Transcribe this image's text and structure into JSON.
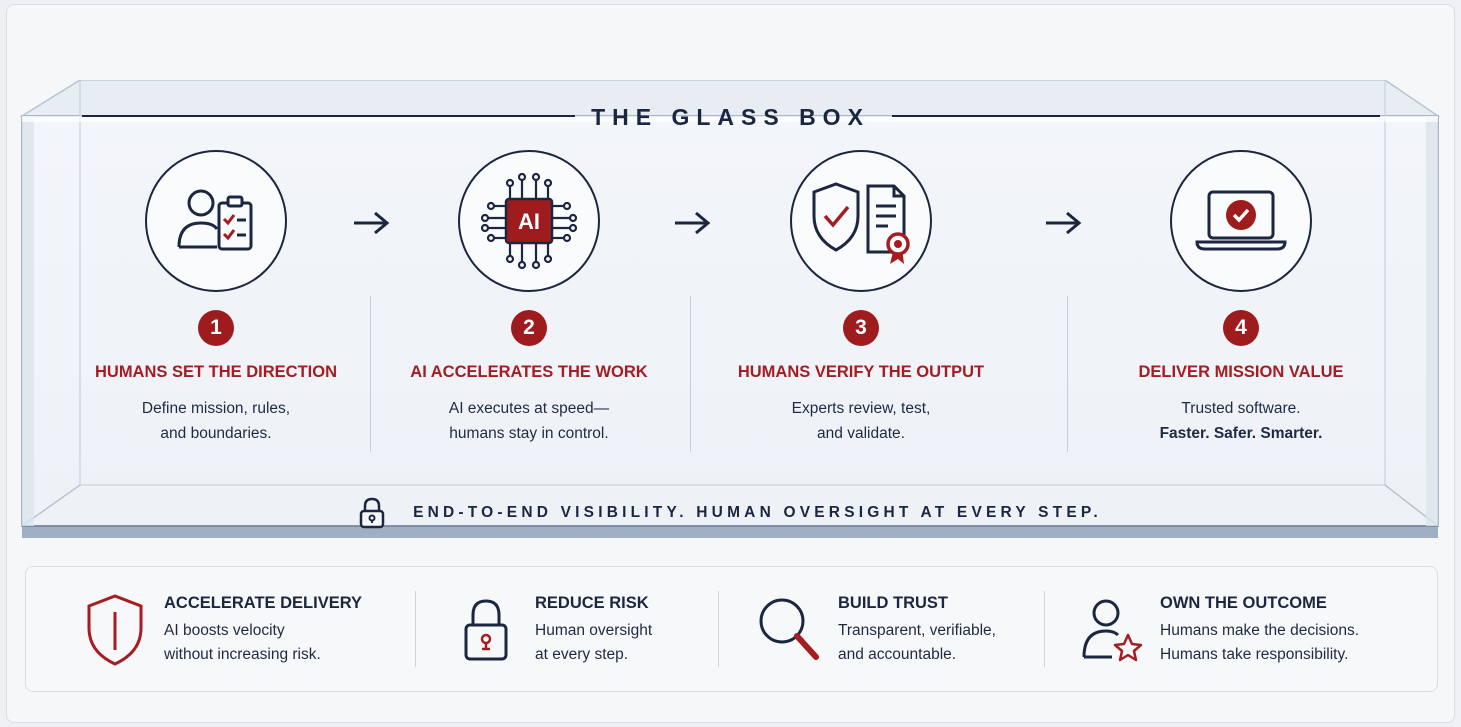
{
  "title": "THE GLASS BOX",
  "steps": [
    {
      "number": "1",
      "heading": "HUMANS SET THE DIRECTION",
      "line1": "Define mission, rules,",
      "line2": "and boundaries.",
      "icon": "person-checklist-icon"
    },
    {
      "number": "2",
      "heading": "AI ACCELERATES THE WORK",
      "line1": "AI executes at speed—",
      "line2": "humans stay in control.",
      "icon": "ai-chip-icon",
      "chip_label": "AI"
    },
    {
      "number": "3",
      "heading": "HUMANS VERIFY THE OUTPUT",
      "line1": "Experts review, test,",
      "line2": "and validate.",
      "icon": "shield-certificate-icon"
    },
    {
      "number": "4",
      "heading": "DELIVER MISSION VALUE",
      "line1": "Trusted software.",
      "line2": "Faster. Safer. Smarter.",
      "icon": "laptop-check-icon"
    }
  ],
  "footer": "END-TO-END VISIBILITY. HUMAN OVERSIGHT AT EVERY STEP.",
  "benefits": [
    {
      "title": "ACCELERATE DELIVERY",
      "line1": "AI boosts velocity",
      "line2": "without increasing risk.",
      "icon": "shield-icon"
    },
    {
      "title": "REDUCE RISK",
      "line1": "Human oversight",
      "line2": "at every step.",
      "icon": "padlock-icon"
    },
    {
      "title": "BUILD TRUST",
      "line1": "Transparent, verifiable,",
      "line2": "and accountable.",
      "icon": "magnifier-icon"
    },
    {
      "title": "OWN THE OUTCOME",
      "line1": "Humans make the decisions.",
      "line2": "Humans take responsibility.",
      "icon": "person-star-icon"
    }
  ],
  "colors": {
    "navy": "#1b2640",
    "red": "#a51d21",
    "badge": "#9e1b1e"
  }
}
